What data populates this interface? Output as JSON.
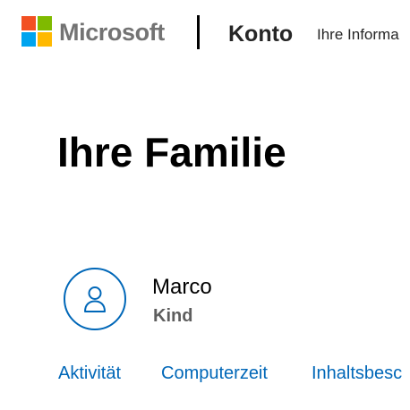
{
  "header": {
    "brand": "Microsoft",
    "section_title": "Konto",
    "nav_link": "Ihre Informa",
    "logo_colors": {
      "top_left": "#f25022",
      "top_right": "#7fba00",
      "bottom_left": "#00a4ef",
      "bottom_right": "#ffb900"
    }
  },
  "main": {
    "title": "Ihre Familie",
    "member": {
      "avatar_icon": "person-icon",
      "name": "Marco",
      "role": "Kind",
      "links": [
        "Aktivität",
        "Computerzeit",
        "Inhaltsbesc"
      ]
    }
  },
  "colors": {
    "accent": "#0067b8",
    "brand_text": "#737373",
    "secondary_text": "#5e5e5e"
  }
}
